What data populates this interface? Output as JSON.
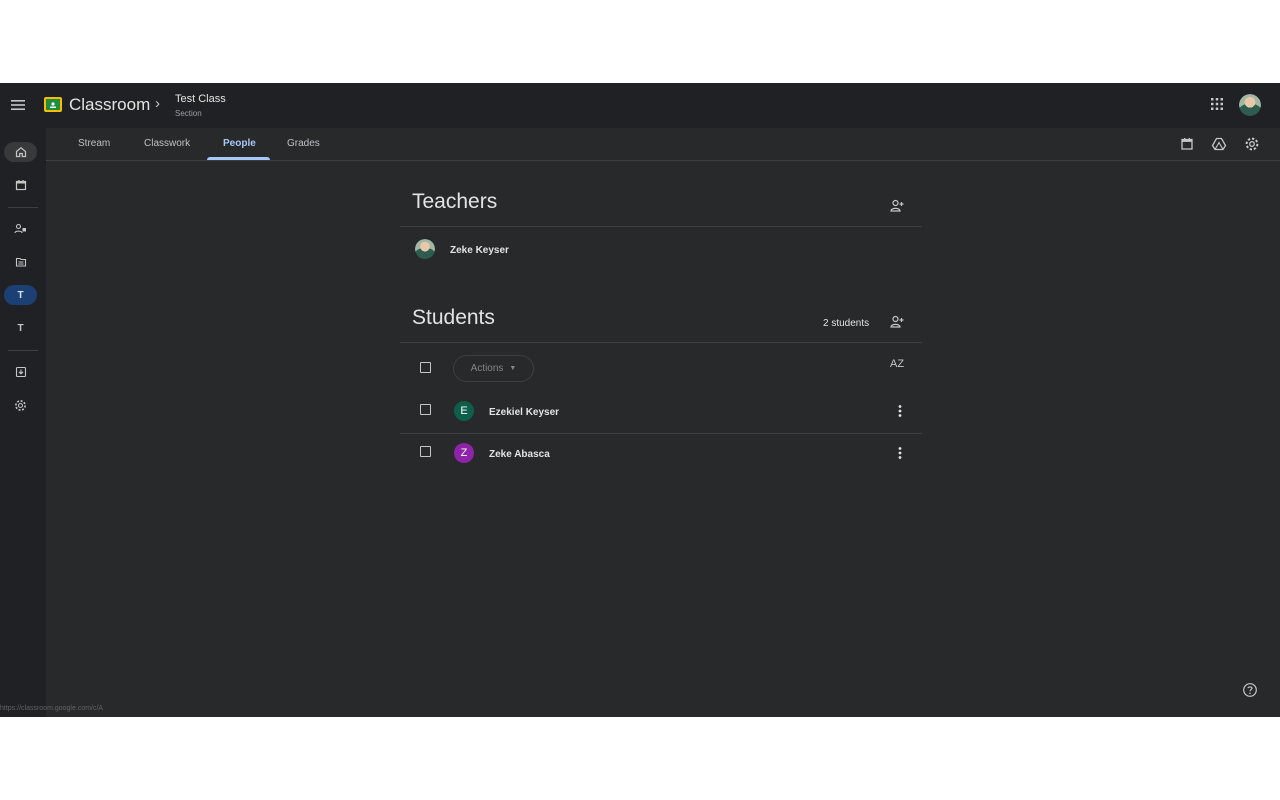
{
  "header": {
    "app_title": "Classroom",
    "class_name": "Test Class",
    "class_section": "Section"
  },
  "tabs": [
    {
      "label": "Stream"
    },
    {
      "label": "Classwork"
    },
    {
      "label": "People"
    },
    {
      "label": "Grades"
    }
  ],
  "teachers": {
    "title": "Teachers",
    "list": [
      {
        "name": "Zeke Keyser"
      }
    ]
  },
  "students": {
    "title": "Students",
    "count_label": "2 students",
    "actions_label": "Actions",
    "sort_label": "AZ",
    "list": [
      {
        "name": "Ezekiel Keyser",
        "initial": "E",
        "color": "#0d5e4b"
      },
      {
        "name": "Zeke Abasca",
        "initial": "Z",
        "color": "#8e24aa"
      }
    ]
  },
  "rail": {
    "class_initials": [
      "T",
      "T"
    ]
  },
  "status_url": "https://classroom.google.com/c/A"
}
